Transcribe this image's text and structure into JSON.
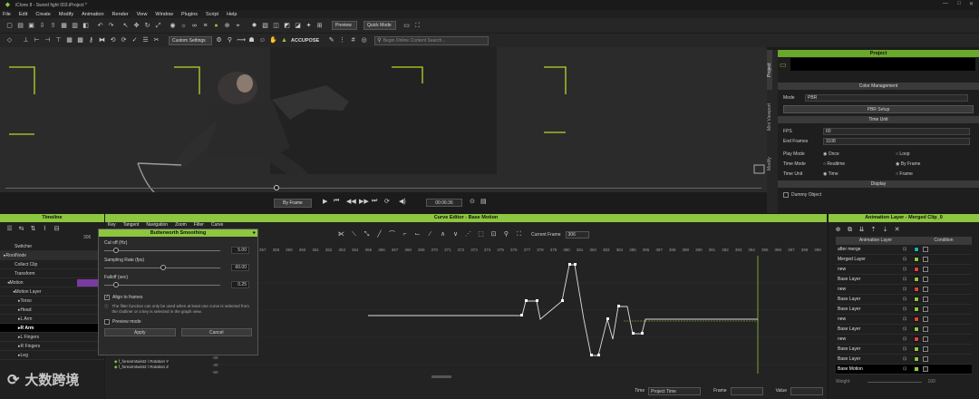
{
  "window": {
    "title": "iClone 8 - Sword fight 003.iProject *"
  },
  "menu": [
    "File",
    "Edit",
    "Create",
    "Modify",
    "Animation",
    "Render",
    "View",
    "Window",
    "Plugins",
    "Script",
    "Help"
  ],
  "toolbar": {
    "preview": "Preview",
    "quick_mode": "Quick Mode",
    "custom_settings": "Custom Settings",
    "accupose": "ACCUPOSE",
    "search_placeholder": "Begin Online Content Search..."
  },
  "viewport": {
    "by_frame": "By Frame",
    "timecode": "00:06:36"
  },
  "project": {
    "title": "Project",
    "color_mgmt": "Color Management",
    "mode_label": "Mode",
    "mode_value": "PBR",
    "pbr_setup": "PBR Setup",
    "time_unit": "Time Unit",
    "fps_label": "FPS",
    "fps_value": "60",
    "end_frame_label": "End Frames",
    "end_frame_value": "1108",
    "play_mode_label": "Play Mode",
    "play_once": "Once",
    "play_loop": "Loop",
    "time_mode_label": "Time Mode",
    "time_realtime": "Realtime",
    "time_byframe": "By Frame",
    "time_unit_label": "Time Unit",
    "unit_time": "Time",
    "unit_frame": "Frame",
    "display": "Display",
    "dummy_object": "Dummy Object",
    "side_tabs": [
      "Project",
      "Mini Viewport",
      "Modify"
    ]
  },
  "timeline": {
    "title": "Timeline",
    "frame_no": "306",
    "rows": [
      "Switcher",
      "RootNode",
      "Collect Clip",
      "Transform",
      "Motion",
      "Motion Layer",
      "Torso",
      "Head",
      "L Arm",
      "R Arm",
      "L Fingers",
      "R Fingers",
      "Leg"
    ]
  },
  "curve_editor": {
    "title": "Curve Editor - Base Motion",
    "menu": [
      "Key",
      "Tangent",
      "Navigation",
      "Zoom",
      "Filter",
      "Curve"
    ],
    "current_frame_label": "Current Frame",
    "current_frame_value": "306",
    "ruler": [
      "357",
      "358",
      "359",
      "360",
      "361",
      "362",
      "363",
      "364",
      "365",
      "366",
      "367",
      "368",
      "369",
      "370",
      "371",
      "372",
      "373",
      "374",
      "375",
      "376",
      "377",
      "378",
      "379",
      "380",
      "381",
      "382",
      "383",
      "384",
      "385",
      "386",
      "387",
      "388",
      "389",
      "390",
      "391",
      "392",
      "393",
      "394",
      "395",
      "396",
      "397",
      "398",
      "399"
    ],
    "outliner": [
      "f_forearmtwist2 \\ Rotation Y",
      "f_forearmtwist2 \\ Rotation Z"
    ],
    "axis_vals": [
      "-20",
      "-40",
      "-60"
    ],
    "footer": {
      "time_label": "Time",
      "time_value": "Project Time",
      "frame_label": "Frame",
      "value_label": "Value"
    }
  },
  "dialog": {
    "title": "Butterworth Smoothing",
    "cutoff_label": "Cut off (Hz)",
    "cutoff_value": "5.00",
    "sampling_label": "Sampling Rate (fps)",
    "sampling_value": "60.00",
    "falloff_label": "Falloff (sec)",
    "falloff_value": "0.25",
    "align_label": "Align to frames",
    "info": "The filter function can only be used when at least one curve is selected from the Outliner or a key is selected in the graph view.",
    "preview_label": "Preview mode",
    "apply": "Apply",
    "cancel": "Cancel"
  },
  "anim_layer": {
    "title": "Animation Layer - Merged Clip_0",
    "col_layer": "Animation Layer",
    "col_condition": "Condition",
    "rows": [
      {
        "name": "after merge",
        "color": "#1ab0b0"
      },
      {
        "name": "Merged Layer",
        "color": "#8dc63f"
      },
      {
        "name": "new",
        "color": "#e04040"
      },
      {
        "name": "Base Layer",
        "color": "#8dc63f"
      },
      {
        "name": "new",
        "color": "#e04040"
      },
      {
        "name": "Base Layer",
        "color": "#8dc63f"
      },
      {
        "name": "Base Layer",
        "color": "#8dc63f"
      },
      {
        "name": "new",
        "color": "#e04040"
      },
      {
        "name": "Base Layer",
        "color": "#8dc63f"
      },
      {
        "name": "new",
        "color": "#e04040"
      },
      {
        "name": "Base Layer",
        "color": "#8dc63f"
      },
      {
        "name": "Base Layer",
        "color": "#8dc63f"
      },
      {
        "name": "Base Motion",
        "color": "#8dc63f"
      }
    ],
    "weight_label": "Weight",
    "weight_value": "100"
  },
  "watermark": "大数跨境",
  "colors": {
    "accent": "#8dc63f"
  }
}
